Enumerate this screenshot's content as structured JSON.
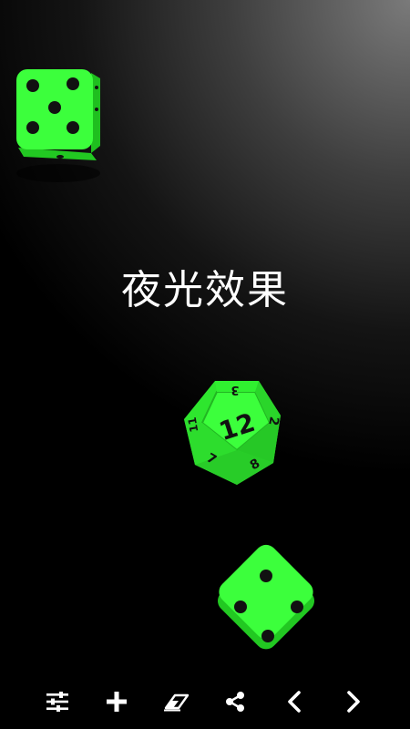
{
  "screen": {
    "caption": "夜光效果"
  },
  "dice": [
    {
      "type": "d6",
      "face_value": 5
    },
    {
      "type": "d12",
      "face_value": 12,
      "side_numbers": [
        "3",
        "2",
        "8",
        "7",
        "11"
      ]
    },
    {
      "type": "d6",
      "face_value": 3
    }
  ],
  "toolbar": {
    "icons": [
      "settings-sliders-icon",
      "add-icon",
      "eraser-icon",
      "share-icon",
      "chevron-left-icon",
      "chevron-right-icon"
    ]
  },
  "colors": {
    "die_face": "#3cff3c",
    "die_edge": "#1fbf1f",
    "pip": "#111111",
    "icon": "#ffffff",
    "caption": "#ffffff"
  }
}
